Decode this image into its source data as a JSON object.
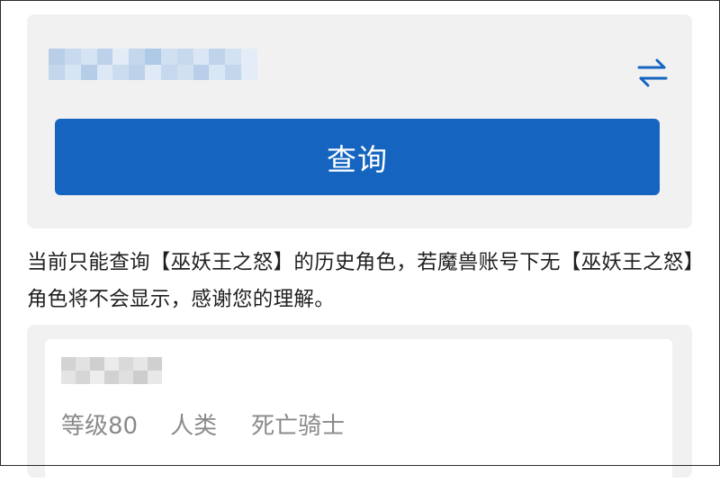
{
  "query_panel": {
    "account_masked": "",
    "swap_icon": "swap-arrows-icon",
    "query_button_label": "查询"
  },
  "notice_text": "当前只能查询【巫妖王之怒】的历史角色，若魔兽账号下无【巫妖王之怒】角色将不会显示，感谢您的理解。",
  "characters": [
    {
      "name_masked": "",
      "level": "等级80",
      "race": "人类",
      "class": "死亡骑士"
    }
  ],
  "colors": {
    "accent": "#1565c0",
    "card_background": "#f1f1f2",
    "meta_text": "#8a8a8a",
    "body_text": "#1f1f1f"
  }
}
